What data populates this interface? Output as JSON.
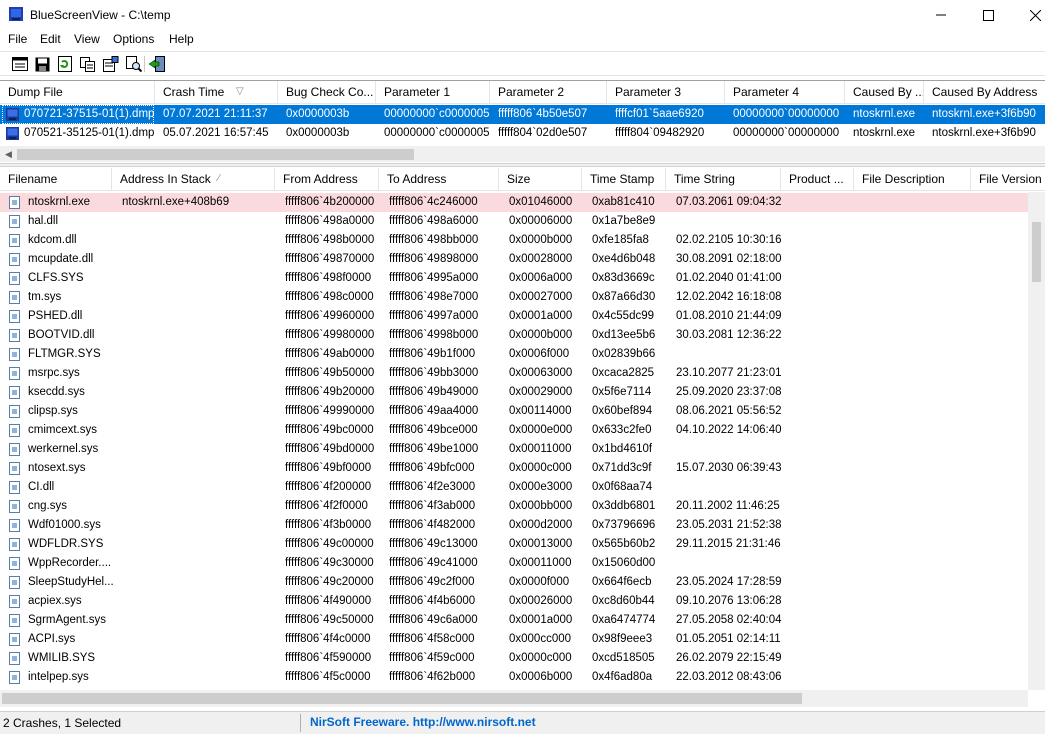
{
  "window": {
    "title": "BlueScreenView  -  C:\\temp"
  },
  "menu": {
    "items": [
      "File",
      "Edit",
      "View",
      "Options",
      "Help"
    ]
  },
  "toolbar": {
    "buttons": [
      "html-report-icon",
      "save-icon",
      "refresh-icon",
      "copy-icon",
      "properties-icon",
      "find-icon",
      "exit-icon"
    ]
  },
  "crashes": {
    "columns": [
      "Dump File",
      "Crash Time",
      "Bug Check Co...",
      "Parameter 1",
      "Parameter 2",
      "Parameter 3",
      "Parameter 4",
      "Caused By ...",
      "Caused By Address"
    ],
    "sort_indicator": "▽",
    "rows": [
      [
        "070721-37515-01(1).dmp",
        "07.07.2021 21:11:37",
        "0x0000003b",
        "00000000`c0000005",
        "fffff806`4b50e507",
        "ffffcf01`5aae6920",
        "00000000`00000000",
        "ntoskrnl.exe",
        "ntoskrnl.exe+3f6b90"
      ],
      [
        "070521-35125-01(1).dmp",
        "05.07.2021 16:57:45",
        "0x0000003b",
        "00000000`c0000005",
        "fffff804`02d0e507",
        "fffff804`09482920",
        "00000000`00000000",
        "ntoskrnl.exe",
        "ntoskrnl.exe+3f6b90"
      ]
    ]
  },
  "modules": {
    "columns": [
      "Filename",
      "Address In Stack",
      "From Address",
      "To Address",
      "Size",
      "Time Stamp",
      "Time String",
      "Product ...",
      "File Description",
      "File Version"
    ],
    "sort_indicator": "∕",
    "rows": [
      [
        "ntoskrnl.exe",
        "ntoskrnl.exe+408b69",
        "fffff806`4b200000",
        "fffff806`4c246000",
        "0x01046000",
        "0xab81c410",
        "07.03.2061 09:04:32"
      ],
      [
        "hal.dll",
        "",
        "fffff806`498a0000",
        "fffff806`498a6000",
        "0x00006000",
        "0x1a7be8e9",
        ""
      ],
      [
        "kdcom.dll",
        "",
        "fffff806`498b0000",
        "fffff806`498bb000",
        "0x0000b000",
        "0xfe185fa8",
        "02.02.2105 10:30:16"
      ],
      [
        "mcupdate.dll",
        "",
        "fffff806`49870000",
        "fffff806`49898000",
        "0x00028000",
        "0xe4d6b048",
        "30.08.2091 02:18:00"
      ],
      [
        "CLFS.SYS",
        "",
        "fffff806`498f0000",
        "fffff806`4995a000",
        "0x0006a000",
        "0x83d3669c",
        "01.02.2040 01:41:00"
      ],
      [
        "tm.sys",
        "",
        "fffff806`498c0000",
        "fffff806`498e7000",
        "0x00027000",
        "0x87a66d30",
        "12.02.2042 16:18:08"
      ],
      [
        "PSHED.dll",
        "",
        "fffff806`49960000",
        "fffff806`4997a000",
        "0x0001a000",
        "0x4c55dc99",
        "01.08.2010 21:44:09"
      ],
      [
        "BOOTVID.dll",
        "",
        "fffff806`49980000",
        "fffff806`4998b000",
        "0x0000b000",
        "0xd13ee5b6",
        "30.03.2081 12:36:22"
      ],
      [
        "FLTMGR.SYS",
        "",
        "fffff806`49ab0000",
        "fffff806`49b1f000",
        "0x0006f000",
        "0x02839b66",
        ""
      ],
      [
        "msrpc.sys",
        "",
        "fffff806`49b50000",
        "fffff806`49bb3000",
        "0x00063000",
        "0xcaca2825",
        "23.10.2077 21:23:01"
      ],
      [
        "ksecdd.sys",
        "",
        "fffff806`49b20000",
        "fffff806`49b49000",
        "0x00029000",
        "0x5f6e7114",
        "25.09.2020 23:37:08"
      ],
      [
        "clipsp.sys",
        "",
        "fffff806`49990000",
        "fffff806`49aa4000",
        "0x00114000",
        "0x60bef894",
        "08.06.2021 05:56:52"
      ],
      [
        "cmimcext.sys",
        "",
        "fffff806`49bc0000",
        "fffff806`49bce000",
        "0x0000e000",
        "0x633c2fe0",
        "04.10.2022 14:06:40"
      ],
      [
        "werkernel.sys",
        "",
        "fffff806`49bd0000",
        "fffff806`49be1000",
        "0x00011000",
        "0x1bd4610f",
        ""
      ],
      [
        "ntosext.sys",
        "",
        "fffff806`49bf0000",
        "fffff806`49bfc000",
        "0x0000c000",
        "0x71dd3c9f",
        "15.07.2030 06:39:43"
      ],
      [
        "CI.dll",
        "",
        "fffff806`4f200000",
        "fffff806`4f2e3000",
        "0x000e3000",
        "0x0f68aa74",
        ""
      ],
      [
        "cng.sys",
        "",
        "fffff806`4f2f0000",
        "fffff806`4f3ab000",
        "0x000bb000",
        "0x3ddb6801",
        "20.11.2002 11:46:25"
      ],
      [
        "Wdf01000.sys",
        "",
        "fffff806`4f3b0000",
        "fffff806`4f482000",
        "0x000d2000",
        "0x73796696",
        "23.05.2031 21:52:38"
      ],
      [
        "WDFLDR.SYS",
        "",
        "fffff806`49c00000",
        "fffff806`49c13000",
        "0x00013000",
        "0x565b60b2",
        "29.11.2015 21:31:46"
      ],
      [
        "WppRecorder....",
        "",
        "fffff806`49c30000",
        "fffff806`49c41000",
        "0x00011000",
        "0x15060d00",
        ""
      ],
      [
        "SleepStudyHel...",
        "",
        "fffff806`49c20000",
        "fffff806`49c2f000",
        "0x0000f000",
        "0x664f6ecb",
        "23.05.2024 17:28:59"
      ],
      [
        "acpiex.sys",
        "",
        "fffff806`4f490000",
        "fffff806`4f4b6000",
        "0x00026000",
        "0xc8d60b44",
        "09.10.2076 13:06:28"
      ],
      [
        "SgrmAgent.sys",
        "",
        "fffff806`49c50000",
        "fffff806`49c6a000",
        "0x0001a000",
        "0xa6474774",
        "27.05.2058 02:40:04"
      ],
      [
        "ACPI.sys",
        "",
        "fffff806`4f4c0000",
        "fffff806`4f58c000",
        "0x000cc000",
        "0x98f9eee3",
        "01.05.2051 02:14:11"
      ],
      [
        "WMILIB.SYS",
        "",
        "fffff806`4f590000",
        "fffff806`4f59c000",
        "0x0000c000",
        "0xcd518505",
        "26.02.2079 22:15:49"
      ],
      [
        "intelpep.sys",
        "",
        "fffff806`4f5c0000",
        "fffff806`4f62b000",
        "0x0006b000",
        "0x4f6ad80a",
        "22.03.2012 08:43:06"
      ]
    ]
  },
  "status": {
    "crashes_text": "2 Crashes, 1 Selected",
    "link_text": "NirSoft Freeware.  http://www.nirsoft.net"
  },
  "colors": {
    "selection": "#0078d7",
    "highlight_row": "#fadadd",
    "link": "#0066cc"
  }
}
